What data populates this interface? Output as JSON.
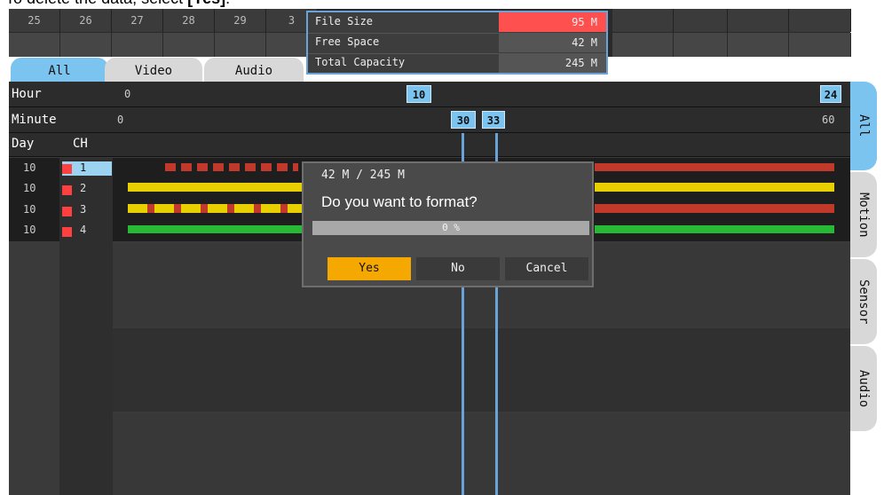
{
  "caption": {
    "prefix": "To delete the data, select ",
    "bold": "[Yes]",
    "suffix": "."
  },
  "calendar": {
    "days": [
      "25",
      "26",
      "27",
      "28",
      "29",
      "3"
    ]
  },
  "info": {
    "rows": [
      {
        "label": "File Size",
        "value": "95 M"
      },
      {
        "label": "Free Space",
        "value": "42 M"
      },
      {
        "label": "Total Capacity",
        "value": "245 M"
      }
    ]
  },
  "tabs": [
    "All",
    "Video",
    "Audio"
  ],
  "timeline": {
    "hour_label": "Hour",
    "hour_start": "0",
    "hour_mark": "10",
    "hour_end": "24",
    "minute_label": "Minute",
    "minute_start": "0",
    "minute_mark1": "30",
    "minute_mark2": "33",
    "minute_end": "60",
    "day_header": "Day",
    "ch_header": "CH"
  },
  "channels": [
    {
      "day": "10",
      "ch": "1"
    },
    {
      "day": "10",
      "ch": "2"
    },
    {
      "day": "10",
      "ch": "3"
    },
    {
      "day": "10",
      "ch": "4"
    }
  ],
  "right_tabs": [
    "All",
    "Motion",
    "Sensor",
    "Audio"
  ],
  "dialog": {
    "usage": "42 M / 245 M",
    "question": "Do you want to format?",
    "progress_text": "0 %",
    "progress": 0,
    "yes": "Yes",
    "no": "No",
    "cancel": "Cancel"
  },
  "colors": {
    "accent": "#f5a800",
    "marker": "#7cc4f0",
    "alert": "#ff5050"
  }
}
